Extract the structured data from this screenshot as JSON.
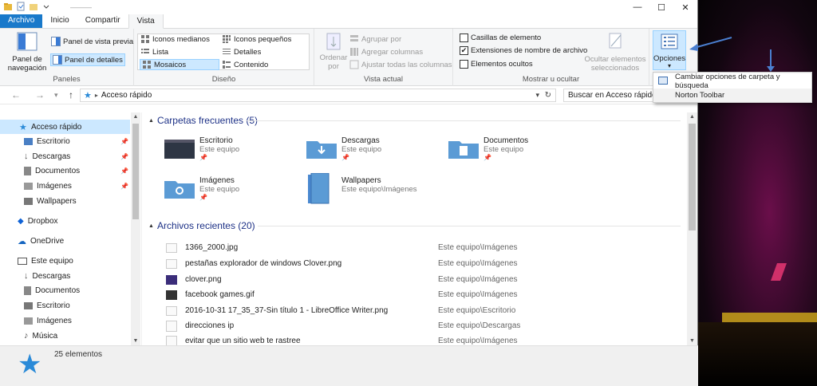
{
  "window": {
    "title": "———",
    "controls": {
      "minimize": "—",
      "maximize": "☐",
      "close": "✕"
    }
  },
  "tabs": [
    {
      "label": "Archivo",
      "type": "file"
    },
    {
      "label": "Inicio"
    },
    {
      "label": "Compartir"
    },
    {
      "label": "Vista",
      "active": true
    }
  ],
  "ribbon": {
    "paneles": {
      "label": "Paneles",
      "nav_pane": "Panel de navegación",
      "preview": "Panel de vista previa",
      "details": "Panel de detalles"
    },
    "diseno": {
      "label": "Diseño",
      "items": [
        "Iconos medianos",
        "Iconos pequeños",
        "Lista",
        "Detalles",
        "Mosaicos",
        "Contenido"
      ],
      "selected": "Mosaicos"
    },
    "vista_actual": {
      "label": "Vista actual",
      "sort": "Ordenar por",
      "group": "Agrupar por",
      "add_columns": "Agregar columnas",
      "fit_columns": "Ajustar todas las columnas"
    },
    "mostrar": {
      "label": "Mostrar u ocultar",
      "checkboxes": [
        {
          "label": "Casillas de elemento",
          "checked": false
        },
        {
          "label": "Extensiones de nombre de archivo",
          "checked": true
        },
        {
          "label": "Elementos ocultos",
          "checked": false
        }
      ],
      "hide_selected": "Ocultar elementos seleccionados"
    },
    "opciones": {
      "label": "Opciones"
    }
  },
  "address": {
    "path": "Acceso rápido",
    "search_placeholder": "Buscar en Acceso rápido"
  },
  "nav": {
    "items": [
      {
        "label": "Acceso rápido",
        "icon": "star-icon",
        "selected": true
      },
      {
        "label": "Escritorio",
        "icon": "desktop-icon",
        "pinned": true
      },
      {
        "label": "Descargas",
        "icon": "download-icon",
        "pinned": true
      },
      {
        "label": "Documentos",
        "icon": "document-icon",
        "pinned": true
      },
      {
        "label": "Imágenes",
        "icon": "pictures-icon",
        "pinned": true
      },
      {
        "label": "Wallpapers",
        "icon": "folder-icon"
      },
      {
        "label": "Dropbox",
        "icon": "dropbox-icon"
      },
      {
        "label": "OneDrive",
        "icon": "cloud-icon"
      },
      {
        "label": "Este equipo",
        "icon": "computer-icon"
      },
      {
        "label": "Descargas",
        "icon": "download-icon"
      },
      {
        "label": "Documentos",
        "icon": "document-icon"
      },
      {
        "label": "Escritorio",
        "icon": "desktop-icon"
      },
      {
        "label": "Imágenes",
        "icon": "pictures-icon"
      },
      {
        "label": "Música",
        "icon": "music-icon"
      }
    ]
  },
  "frequent": {
    "header": "Carpetas frecuentes (5)",
    "folders": [
      {
        "name": "Escritorio",
        "location": "Este equipo"
      },
      {
        "name": "Descargas",
        "location": "Este equipo"
      },
      {
        "name": "Documentos",
        "location": "Este equipo"
      },
      {
        "name": "Imágenes",
        "location": "Este equipo"
      },
      {
        "name": "Wallpapers",
        "location": "Este equipo\\Imágenes"
      }
    ]
  },
  "recent": {
    "header": "Archivos recientes (20)",
    "files": [
      {
        "name": "1366_2000.jpg",
        "path": "Este equipo\\Imágenes"
      },
      {
        "name": "pestañas explorador de windows Clover.png",
        "path": "Este equipo\\Imágenes"
      },
      {
        "name": "clover.png",
        "path": "Este equipo\\Imágenes"
      },
      {
        "name": "facebook games.gif",
        "path": "Este equipo\\Imágenes"
      },
      {
        "name": "2016-10-31 17_35_37-Sin título 1 - LibreOffice Writer.png",
        "path": "Este equipo\\Escritorio"
      },
      {
        "name": "direcciones ip",
        "path": "Este equipo\\Descargas"
      },
      {
        "name": "evitar que un sitio web te rastree",
        "path": "Este equipo\\Imágenes"
      }
    ]
  },
  "status": {
    "count": "25 elementos"
  },
  "menu": {
    "items": [
      {
        "label": "Cambiar opciones de carpeta y búsqueda"
      },
      {
        "label": "Norton Toolbar"
      }
    ]
  },
  "colors": {
    "accent": "#1979ca",
    "folder_blue": "#5b9bd5",
    "section_heading": "#1e3287",
    "selection": "#cce8ff"
  }
}
